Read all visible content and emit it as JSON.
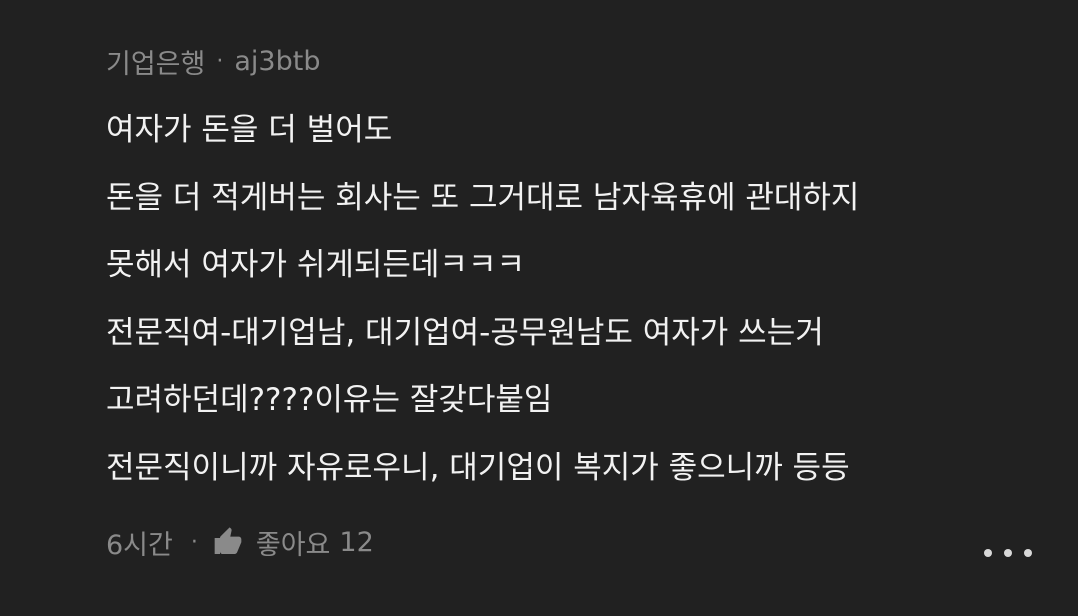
{
  "comment": {
    "board": "기업은행",
    "separator": "·",
    "author": "aj3btb",
    "lines": [
      "여자가 돈을 더 벌어도",
      "돈을 더 적게버는 회사는 또 그거대로 남자육휴에 관대하지",
      "못해서 여자가 쉬게되든데ㅋㅋㅋ",
      "전문직여-대기업남, 대기업여-공무원남도 여자가 쓰는거",
      "고려하던데????이유는 잘갖다붙임",
      "전문직이니까 자유로우니, 대기업이 복지가 좋으니까 등등"
    ],
    "time": "6시간",
    "like_label": "좋아요",
    "like_count": "12",
    "icons": {
      "like": "thumbs-up-icon",
      "more": "more-dots-icon"
    },
    "colors": {
      "background": "#212121",
      "text": "#f2f2f2",
      "meta": "#8a8a8a"
    }
  }
}
